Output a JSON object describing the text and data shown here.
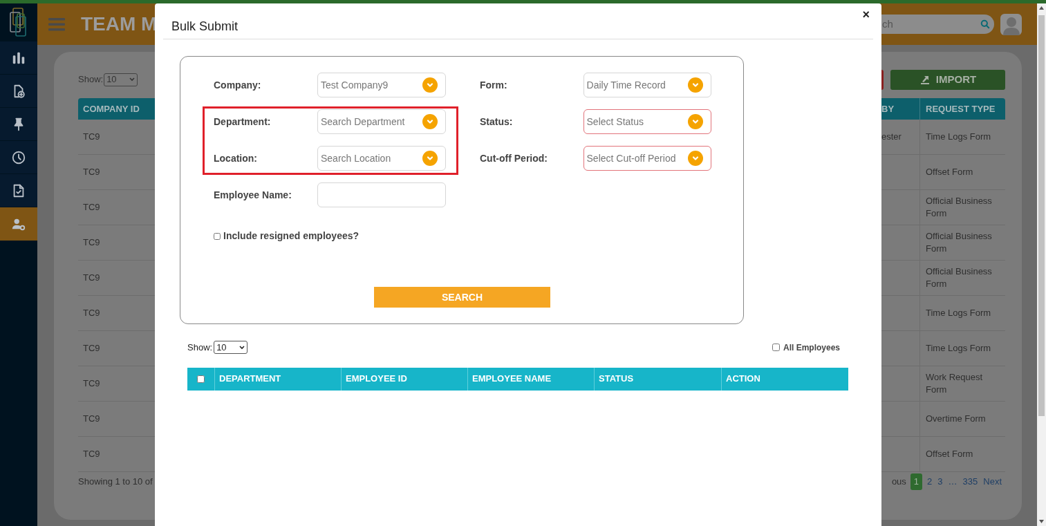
{
  "sidebar": {
    "items": [
      {
        "selected": false
      },
      {
        "selected": false
      },
      {
        "selected": false
      },
      {
        "selected": false
      },
      {
        "selected": false
      },
      {
        "selected": true
      }
    ]
  },
  "header": {
    "title": "TEAM M",
    "search": {
      "placeholder": "ch"
    }
  },
  "background": {
    "show_label": "Show:",
    "page_size": "10",
    "import_button": "IMPORT",
    "columns": [
      "COMPANY ID",
      "BY",
      "REQUEST TYPE"
    ],
    "rows": [
      {
        "company_id": "TC9",
        "by": "ester",
        "request_type": "Time Logs Form"
      },
      {
        "company_id": "TC9",
        "request_type": "Offset Form"
      },
      {
        "company_id": "TC9",
        "request_type": "Official Business Form"
      },
      {
        "company_id": "TC9",
        "request_type": "Official Business Form"
      },
      {
        "company_id": "TC9",
        "request_type": "Official Business Form"
      },
      {
        "company_id": "TC9",
        "request_type": "Time Logs Form"
      },
      {
        "company_id": "TC9",
        "request_type": "Time Logs Form"
      },
      {
        "company_id": "TC9",
        "request_type": "Work Request Form"
      },
      {
        "company_id": "TC9",
        "request_type": "Overtime Form"
      },
      {
        "company_id": "TC9",
        "request_type": "Offset Form"
      }
    ],
    "summary": "Showing 1 to 10 of",
    "pagination": [
      {
        "label": "ous",
        "selected": false
      },
      {
        "label": "1",
        "selected": true
      },
      {
        "label": "2",
        "selected": false
      },
      {
        "label": "3",
        "selected": false
      },
      {
        "label": "…",
        "selected": false
      },
      {
        "label": "335",
        "selected": false
      },
      {
        "label": "Next",
        "selected": false
      }
    ]
  },
  "modal": {
    "title": "Bulk Submit",
    "close": "×",
    "filters": [
      {
        "label": "Company:",
        "kind": "select",
        "value": "Test Company9",
        "invalid": false
      },
      {
        "label": "Form:",
        "kind": "select",
        "value": "Daily Time Record",
        "invalid": false
      },
      {
        "label": "Department:",
        "kind": "select",
        "placeholder": "Search Department",
        "invalid": false
      },
      {
        "label": "Status:",
        "kind": "select",
        "placeholder": "Select Status",
        "invalid": true
      },
      {
        "label": "Location:",
        "kind": "select",
        "placeholder": "Search Location",
        "invalid": false
      },
      {
        "label": "Cut-off Period:",
        "kind": "select",
        "placeholder": "Select Cut-off Period",
        "invalid": true
      },
      {
        "label": "Employee Name:",
        "kind": "text",
        "invalid": false
      }
    ],
    "include_resigned": {
      "label": "Include resigned employees?",
      "checked": false
    },
    "search_button": "SEARCH",
    "results": {
      "show_label": "Show:",
      "page_size": "10",
      "all_employees": {
        "label": "All Employees",
        "checked": false
      },
      "select_all_checked": false,
      "columns": [
        "DEPARTMENT",
        "EMPLOYEE ID",
        "EMPLOYEE NAME",
        "STATUS",
        "ACTION"
      ]
    }
  }
}
